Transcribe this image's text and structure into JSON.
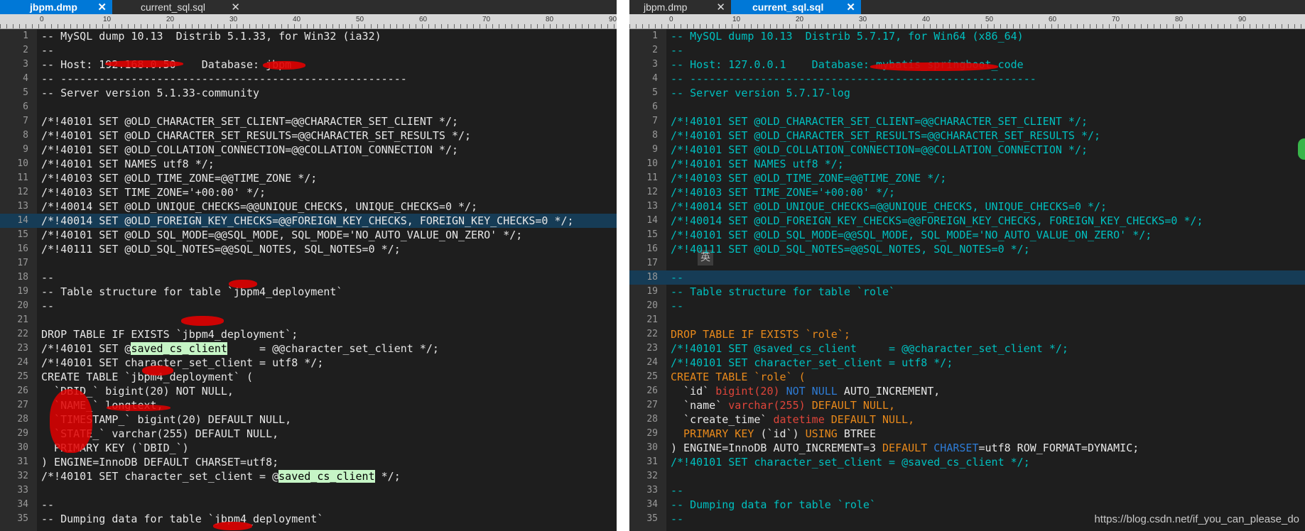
{
  "left": {
    "tabs": [
      {
        "label": "jbpm.dmp",
        "active": true
      },
      {
        "label": "current_sql.sql",
        "active": false
      }
    ],
    "ruler_ticks": [
      "0",
      "10",
      "20",
      "30",
      "40",
      "50",
      "60",
      "70",
      "80",
      "90"
    ],
    "lines": [
      {
        "n": "1",
        "text": "-- MySQL dump 10.13  Distrib 5.1.33, for Win32 (ia32)"
      },
      {
        "n": "2",
        "text": "--"
      },
      {
        "n": "3",
        "text": "-- Host: 192.168.0.50    Database: jbpm"
      },
      {
        "n": "4",
        "text": "-- ------------------------------------------------------"
      },
      {
        "n": "5",
        "text": "-- Server version 5.1.33-community"
      },
      {
        "n": "6",
        "text": ""
      },
      {
        "n": "7",
        "text": "/*!40101 SET @OLD_CHARACTER_SET_CLIENT=@@CHARACTER_SET_CLIENT */;"
      },
      {
        "n": "8",
        "text": "/*!40101 SET @OLD_CHARACTER_SET_RESULTS=@@CHARACTER_SET_RESULTS */;"
      },
      {
        "n": "9",
        "text": "/*!40101 SET @OLD_COLLATION_CONNECTION=@@COLLATION_CONNECTION */;"
      },
      {
        "n": "10",
        "text": "/*!40101 SET NAMES utf8 */;"
      },
      {
        "n": "11",
        "text": "/*!40103 SET @OLD_TIME_ZONE=@@TIME_ZONE */;"
      },
      {
        "n": "12",
        "text": "/*!40103 SET TIME_ZONE='+00:00' */;"
      },
      {
        "n": "13",
        "text": "/*!40014 SET @OLD_UNIQUE_CHECKS=@@UNIQUE_CHECKS, UNIQUE_CHECKS=0 */;"
      },
      {
        "n": "14",
        "text": "/*!40014 SET @OLD_FOREIGN_KEY_CHECKS=@@FOREIGN_KEY_CHECKS, FOREIGN_KEY_CHECKS=0 */;"
      },
      {
        "n": "15",
        "text": "/*!40101 SET @OLD_SQL_MODE=@@SQL_MODE, SQL_MODE='NO_AUTO_VALUE_ON_ZERO' */;"
      },
      {
        "n": "16",
        "text": "/*!40111 SET @OLD_SQL_NOTES=@@SQL_NOTES, SQL_NOTES=0 */;"
      },
      {
        "n": "17",
        "text": ""
      },
      {
        "n": "18",
        "text": "--"
      },
      {
        "n": "19",
        "text": "-- Table structure for table `jbpm4_deployment`"
      },
      {
        "n": "20",
        "text": "--"
      },
      {
        "n": "21",
        "text": ""
      },
      {
        "n": "22",
        "text": "DROP TABLE IF EXISTS `jbpm4_deployment`;"
      },
      {
        "n": "23",
        "pre": "/*!40101 SET @",
        "sel": "saved_cs_client",
        "post": "     = @@character_set_client */;"
      },
      {
        "n": "24",
        "text": "/*!40101 SET character_set_client = utf8 */;"
      },
      {
        "n": "25",
        "text": "CREATE TABLE `jbpm4_deployment` ("
      },
      {
        "n": "26",
        "text": "  `DBID_` bigint(20) NOT NULL,"
      },
      {
        "n": "27",
        "text": "  `NAME_` longtext,"
      },
      {
        "n": "28",
        "text": "  `TIMESTAMP_` bigint(20) DEFAULT NULL,"
      },
      {
        "n": "29",
        "text": "  `STATE_` varchar(255) DEFAULT NULL,"
      },
      {
        "n": "30",
        "text": "  PRIMARY KEY (`DBID_`)"
      },
      {
        "n": "31",
        "text": ") ENGINE=InnoDB DEFAULT CHARSET=utf8;"
      },
      {
        "n": "32",
        "pre": "/*!40101 SET character_set_client = @",
        "sel": "saved_cs_client",
        "post": " */;"
      },
      {
        "n": "33",
        "text": ""
      },
      {
        "n": "34",
        "text": "--"
      },
      {
        "n": "35",
        "text": "-- Dumping data for table `jbpm4_deployment`"
      }
    ]
  },
  "right": {
    "tabs": [
      {
        "label": "jbpm.dmp",
        "active": false
      },
      {
        "label": "current_sql.sql",
        "active": true
      }
    ],
    "ruler_ticks": [
      "0",
      "10",
      "20",
      "30",
      "40",
      "50",
      "60",
      "70",
      "80",
      "90"
    ],
    "lines": [
      {
        "n": "1",
        "text": "-- MySQL dump 10.13  Distrib 5.7.17, for Win64 (x86_64)"
      },
      {
        "n": "2",
        "text": "--"
      },
      {
        "n": "3",
        "text": "-- Host: 127.0.0.1    Database: mybatis_springboot_code"
      },
      {
        "n": "4",
        "text": "-- ------------------------------------------------------"
      },
      {
        "n": "5",
        "text": "-- Server version 5.7.17-log"
      },
      {
        "n": "6",
        "text": ""
      },
      {
        "n": "7",
        "text": "/*!40101 SET @OLD_CHARACTER_SET_CLIENT=@@CHARACTER_SET_CLIENT */;"
      },
      {
        "n": "8",
        "text": "/*!40101 SET @OLD_CHARACTER_SET_RESULTS=@@CHARACTER_SET_RESULTS */;"
      },
      {
        "n": "9",
        "text": "/*!40101 SET @OLD_COLLATION_CONNECTION=@@COLLATION_CONNECTION */;"
      },
      {
        "n": "10",
        "text": "/*!40101 SET NAMES utf8 */;"
      },
      {
        "n": "11",
        "text": "/*!40103 SET @OLD_TIME_ZONE=@@TIME_ZONE */;"
      },
      {
        "n": "12",
        "text": "/*!40103 SET TIME_ZONE='+00:00' */;"
      },
      {
        "n": "13",
        "text": "/*!40014 SET @OLD_UNIQUE_CHECKS=@@UNIQUE_CHECKS, UNIQUE_CHECKS=0 */;"
      },
      {
        "n": "14",
        "text": "/*!40014 SET @OLD_FOREIGN_KEY_CHECKS=@@FOREIGN_KEY_CHECKS, FOREIGN_KEY_CHECKS=0 */;"
      },
      {
        "n": "15",
        "text": "/*!40101 SET @OLD_SQL_MODE=@@SQL_MODE, SQL_MODE='NO_AUTO_VALUE_ON_ZERO' */;"
      },
      {
        "n": "16",
        "text": "/*!40111 SET @OLD_SQL_NOTES=@@SQL_NOTES, SQL_NOTES=0 */;"
      },
      {
        "n": "17",
        "text": ""
      },
      {
        "n": "18",
        "text": "--"
      },
      {
        "n": "19",
        "text": "-- Table structure for table `role`"
      },
      {
        "n": "20",
        "text": "--"
      },
      {
        "n": "21",
        "text": ""
      },
      {
        "n": "22",
        "parts": [
          [
            "DROP TABLE IF EXISTS `role`;",
            "kw-drop"
          ]
        ]
      },
      {
        "n": "23",
        "text": "/*!40101 SET @saved_cs_client     = @@character_set_client */;"
      },
      {
        "n": "24",
        "text": "/*!40101 SET character_set_client = utf8 */;"
      },
      {
        "n": "25",
        "parts": [
          [
            "CREATE TABLE `role` (",
            "kw-create"
          ]
        ]
      },
      {
        "n": "26",
        "parts": [
          [
            "  `id` ",
            "plain"
          ],
          [
            "bigint(20) ",
            "kw-red"
          ],
          [
            "NOT NULL ",
            "kw-blue"
          ],
          [
            "AUTO_INCREMENT,",
            "plain"
          ]
        ]
      },
      {
        "n": "27",
        "parts": [
          [
            "  `name` ",
            "plain"
          ],
          [
            "varchar(255) ",
            "kw-red"
          ],
          [
            "DEFAULT NULL,",
            "kw-create"
          ]
        ]
      },
      {
        "n": "28",
        "parts": [
          [
            "  `create_time` ",
            "plain"
          ],
          [
            "datetime ",
            "kw-red"
          ],
          [
            "DEFAULT NULL,",
            "kw-create"
          ]
        ]
      },
      {
        "n": "29",
        "parts": [
          [
            "  PRIMARY KEY ",
            "kw-create"
          ],
          [
            "(`id`) ",
            "plain"
          ],
          [
            "USING ",
            "kw-create"
          ],
          [
            "BTREE",
            "plain"
          ]
        ]
      },
      {
        "n": "30",
        "parts": [
          [
            ") ENGINE=InnoDB AUTO_INCREMENT=3 ",
            "plain"
          ],
          [
            "DEFAULT ",
            "kw-create"
          ],
          [
            "CHARSET",
            "kw-blue"
          ],
          [
            "=utf8 ROW_FORMAT=DYNAMIC;",
            "plain"
          ]
        ]
      },
      {
        "n": "31",
        "text": "/*!40101 SET character_set_client = @saved_cs_client */;"
      },
      {
        "n": "32",
        "text": ""
      },
      {
        "n": "33",
        "text": "--"
      },
      {
        "n": "34",
        "text": "-- Dumping data for table `role`"
      },
      {
        "n": "35",
        "text": "--"
      }
    ],
    "ime_char": "英"
  },
  "watermark": "https://blog.csdn.net/if_you_can_please_do",
  "colors": {
    "tab_active": "#0078d7",
    "editor_bg": "#1e1e1e",
    "highlight_line": "#163c56",
    "selection": "#c6f5c6",
    "right_text": "#00bfbf",
    "redaction": "#e00000"
  }
}
